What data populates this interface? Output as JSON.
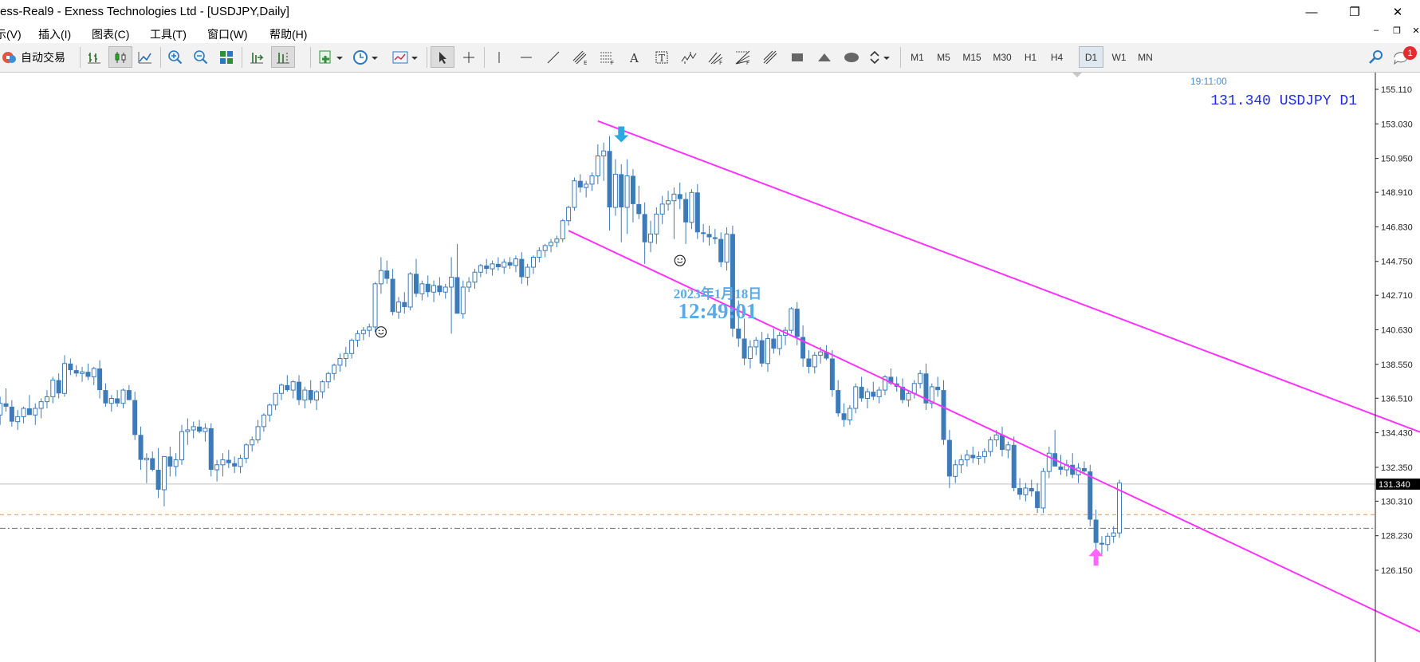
{
  "window": {
    "title": "ess-Real9 - Exness Technologies Ltd - [USDJPY,Daily]",
    "minimize_glyph": "—",
    "restore_glyph": "❐",
    "close_glyph": "✕"
  },
  "menu": {
    "items": [
      "示(V)",
      "插入(I)",
      "图表(C)",
      "工具(T)",
      "窗口(W)",
      "帮助(H)"
    ],
    "mdi_minimize": "–",
    "mdi_restore": "❐",
    "mdi_close": "✕"
  },
  "toolbar": {
    "auto_trade_label": "自动交易",
    "timeframes": [
      "M1",
      "M5",
      "M15",
      "M30",
      "H1",
      "H4",
      "D1",
      "W1",
      "MN"
    ],
    "active_timeframe": "D1",
    "notification_count": "1"
  },
  "chart_data": {
    "type": "candlestick",
    "symbol": "USDJPY",
    "timeframe": "D1",
    "server_time": "19:11:00",
    "price_label": "131.340 USDJPY D1",
    "current_price": 131.34,
    "current_price_tag": "131.340",
    "watermark_date": "2023年1月18日",
    "watermark_time": "12:49:01",
    "ylim": [
      125.4,
      156.5
    ],
    "y_ticks": [
      "155.110",
      "153.030",
      "150.950",
      "148.910",
      "146.830",
      "144.750",
      "142.710",
      "140.630",
      "138.550",
      "136.510",
      "134.430",
      "132.350",
      "130.310",
      "128.230",
      "126.150"
    ],
    "horizontal_lines": [
      {
        "price": 131.34,
        "style": "solid",
        "color": "#c0c0c0"
      },
      {
        "price": 129.5,
        "style": "dashed",
        "color": "#e8914a"
      },
      {
        "price": 128.68,
        "style": "dashdot",
        "color": "#707070"
      }
    ],
    "channel": {
      "color": "#ff33ff",
      "upper": [
        [
          0,
          153.2
        ],
        [
          185,
          129.0
        ]
      ],
      "lower": [
        [
          0,
          146.6
        ],
        [
          185,
          122.0
        ]
      ],
      "start_index": 0
    },
    "markers": [
      {
        "type": "down-arrow",
        "index": 4,
        "price": 152.3,
        "color": "#2aa8e0"
      },
      {
        "type": "up-arrow",
        "index": 82,
        "price": 127.0,
        "color": "#ff66ff"
      },
      {
        "type": "smiley",
        "index": -33,
        "price": 140.5
      },
      {
        "type": "smiley",
        "index": 10,
        "price": 144.8
      }
    ],
    "candles": [
      [
        136.2,
        136.8,
        135.0,
        135.5
      ],
      [
        135.5,
        136.6,
        134.9,
        136.2
      ],
      [
        136.2,
        137.1,
        135.7,
        136.0
      ],
      [
        136.0,
        136.4,
        134.8,
        135.1
      ],
      [
        135.1,
        135.8,
        134.6,
        135.4
      ],
      [
        135.4,
        136.0,
        135.0,
        135.9
      ],
      [
        135.9,
        136.7,
        135.5,
        135.5
      ],
      [
        135.5,
        136.2,
        134.9,
        135.9
      ],
      [
        135.9,
        136.5,
        135.3,
        136.3
      ],
      [
        136.3,
        137.0,
        135.9,
        136.6
      ],
      [
        136.6,
        137.8,
        136.2,
        137.6
      ],
      [
        137.6,
        138.0,
        136.5,
        136.8
      ],
      [
        136.8,
        139.1,
        136.6,
        138.6
      ],
      [
        138.6,
        138.9,
        137.9,
        138.2
      ],
      [
        138.2,
        138.5,
        137.8,
        138.0
      ],
      [
        138.0,
        138.4,
        137.5,
        138.1
      ],
      [
        138.1,
        138.6,
        137.6,
        137.8
      ],
      [
        137.8,
        138.4,
        137.3,
        138.3
      ],
      [
        138.3,
        138.8,
        136.5,
        137.0
      ],
      [
        137.0,
        137.4,
        136.0,
        136.2
      ],
      [
        136.2,
        136.7,
        135.7,
        136.5
      ],
      [
        136.5,
        137.0,
        136.0,
        136.2
      ],
      [
        136.2,
        137.1,
        135.9,
        137.0
      ],
      [
        137.0,
        137.3,
        136.4,
        136.4
      ],
      [
        136.4,
        136.9,
        134.0,
        134.3
      ],
      [
        134.3,
        134.8,
        132.2,
        132.8
      ],
      [
        132.8,
        133.2,
        131.4,
        132.9
      ],
      [
        132.9,
        133.3,
        132.1,
        132.2
      ],
      [
        132.2,
        133.5,
        130.5,
        131.0
      ],
      [
        131.0,
        133.0,
        130.0,
        133.0
      ],
      [
        133.0,
        133.6,
        131.8,
        132.4
      ],
      [
        132.4,
        133.2,
        131.8,
        132.8
      ],
      [
        132.8,
        134.9,
        132.5,
        134.5
      ],
      [
        134.5,
        135.3,
        133.7,
        134.6
      ],
      [
        134.6,
        135.1,
        134.1,
        134.8
      ],
      [
        134.8,
        135.2,
        134.4,
        134.5
      ],
      [
        134.5,
        135.0,
        133.9,
        134.7
      ],
      [
        134.7,
        135.0,
        131.8,
        132.2
      ],
      [
        132.2,
        132.8,
        131.5,
        132.5
      ],
      [
        132.5,
        133.2,
        131.8,
        132.8
      ],
      [
        132.8,
        133.4,
        132.3,
        132.6
      ],
      [
        132.6,
        133.0,
        132.0,
        132.4
      ],
      [
        132.4,
        133.1,
        132.0,
        132.9
      ],
      [
        132.9,
        133.8,
        132.6,
        133.7
      ],
      [
        133.7,
        134.2,
        133.3,
        134.0
      ],
      [
        134.0,
        135.2,
        133.8,
        134.8
      ],
      [
        134.8,
        135.6,
        134.5,
        135.5
      ],
      [
        135.5,
        136.2,
        135.1,
        136.1
      ],
      [
        136.1,
        136.8,
        135.8,
        136.8
      ],
      [
        136.8,
        137.4,
        136.4,
        137.3
      ],
      [
        137.3,
        137.9,
        136.9,
        137.0
      ],
      [
        137.0,
        137.6,
        136.5,
        137.5
      ],
      [
        137.5,
        137.9,
        136.1,
        136.4
      ],
      [
        136.4,
        137.2,
        135.9,
        137.0
      ],
      [
        137.0,
        137.6,
        136.2,
        136.4
      ],
      [
        136.4,
        137.0,
        135.8,
        136.9
      ],
      [
        136.9,
        137.6,
        136.5,
        137.5
      ],
      [
        137.5,
        138.1,
        137.1,
        138.0
      ],
      [
        138.0,
        138.6,
        137.6,
        138.5
      ],
      [
        138.5,
        139.2,
        138.1,
        138.9
      ],
      [
        138.9,
        139.6,
        138.4,
        139.2
      ],
      [
        139.2,
        140.1,
        138.9,
        140.0
      ],
      [
        140.0,
        140.6,
        139.6,
        140.4
      ],
      [
        140.4,
        140.8,
        140.0,
        140.6
      ],
      [
        140.6,
        141.0,
        140.2,
        140.8
      ],
      [
        140.8,
        143.5,
        140.5,
        143.4
      ],
      [
        143.4,
        145.0,
        142.8,
        144.2
      ],
      [
        144.2,
        144.8,
        143.4,
        143.7
      ],
      [
        143.7,
        144.3,
        141.5,
        141.7
      ],
      [
        141.7,
        142.6,
        141.3,
        142.3
      ],
      [
        142.3,
        142.9,
        141.6,
        142.0
      ],
      [
        142.0,
        144.1,
        141.8,
        144.0
      ],
      [
        144.0,
        144.9,
        142.6,
        142.8
      ],
      [
        142.8,
        143.6,
        142.4,
        143.4
      ],
      [
        143.4,
        143.9,
        142.6,
        142.9
      ],
      [
        142.9,
        143.6,
        142.3,
        143.3
      ],
      [
        143.3,
        143.8,
        142.7,
        142.9
      ],
      [
        142.9,
        143.4,
        142.5,
        143.2
      ],
      [
        143.2,
        145.0,
        140.4,
        143.8
      ],
      [
        143.8,
        145.8,
        142.0,
        141.6
      ],
      [
        141.6,
        143.6,
        141.3,
        143.2
      ],
      [
        143.2,
        143.8,
        142.9,
        143.5
      ],
      [
        143.5,
        144.3,
        143.1,
        144.1
      ],
      [
        144.1,
        144.6,
        143.8,
        144.5
      ],
      [
        144.5,
        144.9,
        144.0,
        144.3
      ],
      [
        144.3,
        144.8,
        143.9,
        144.6
      ],
      [
        144.6,
        145.0,
        144.2,
        144.4
      ],
      [
        144.4,
        144.9,
        144.0,
        144.7
      ],
      [
        144.7,
        145.0,
        144.3,
        144.5
      ],
      [
        144.5,
        145.1,
        144.1,
        144.9
      ],
      [
        144.9,
        145.3,
        143.4,
        143.8
      ],
      [
        143.8,
        144.6,
        143.3,
        144.4
      ],
      [
        144.4,
        145.1,
        144.0,
        145.0
      ],
      [
        145.0,
        145.6,
        144.7,
        145.4
      ],
      [
        145.4,
        145.8,
        145.0,
        145.7
      ],
      [
        145.7,
        146.1,
        145.3,
        145.9
      ],
      [
        145.9,
        146.3,
        145.6,
        146.1
      ],
      [
        146.1,
        147.3,
        145.9,
        147.2
      ],
      [
        147.2,
        148.1,
        146.9,
        148.0
      ],
      [
        148.0,
        149.8,
        147.8,
        149.6
      ],
      [
        149.6,
        150.0,
        148.9,
        149.2
      ],
      [
        149.2,
        149.6,
        148.6,
        149.4
      ],
      [
        149.4,
        150.1,
        149.0,
        149.9
      ],
      [
        149.9,
        151.8,
        149.4,
        151.1
      ],
      [
        151.1,
        151.9,
        149.6,
        151.4
      ],
      [
        151.4,
        152.3,
        146.6,
        148.0
      ],
      [
        148.0,
        150.9,
        147.5,
        150.0
      ],
      [
        150.0,
        150.6,
        145.9,
        148.0
      ],
      [
        148.0,
        150.9,
        146.4,
        149.9
      ],
      [
        149.9,
        150.3,
        147.1,
        148.2
      ],
      [
        148.2,
        149.3,
        147.3,
        147.6
      ],
      [
        147.6,
        148.3,
        144.6,
        145.9
      ],
      [
        145.9,
        147.2,
        145.3,
        146.4
      ],
      [
        146.4,
        148.0,
        145.8,
        147.6
      ],
      [
        147.6,
        148.7,
        147.0,
        148.2
      ],
      [
        148.2,
        149.0,
        147.8,
        148.4
      ],
      [
        148.4,
        149.2,
        146.1,
        148.8
      ],
      [
        148.8,
        149.5,
        147.9,
        148.5
      ],
      [
        148.5,
        148.9,
        145.8,
        147.1
      ],
      [
        147.1,
        149.1,
        146.7,
        148.9
      ],
      [
        148.9,
        149.4,
        146.1,
        146.5
      ],
      [
        146.5,
        147.0,
        145.9,
        146.4
      ],
      [
        146.4,
        146.9,
        145.7,
        146.2
      ],
      [
        146.2,
        146.7,
        145.8,
        146.1
      ],
      [
        146.1,
        146.5,
        144.4,
        144.7
      ],
      [
        144.7,
        146.8,
        144.2,
        146.4
      ],
      [
        146.4,
        146.9,
        140.2,
        140.7
      ],
      [
        140.7,
        142.4,
        139.6,
        140.1
      ],
      [
        140.1,
        141.3,
        138.5,
        138.9
      ],
      [
        138.9,
        140.0,
        138.3,
        139.6
      ],
      [
        139.6,
        140.2,
        139.1,
        140.0
      ],
      [
        140.0,
        140.5,
        138.4,
        138.6
      ],
      [
        138.6,
        140.4,
        138.1,
        140.1
      ],
      [
        140.1,
        140.7,
        139.2,
        139.5
      ],
      [
        139.5,
        140.5,
        139.1,
        140.3
      ],
      [
        140.3,
        140.8,
        139.7,
        140.6
      ],
      [
        140.6,
        142.0,
        140.4,
        141.9
      ],
      [
        141.9,
        142.3,
        139.7,
        140.2
      ],
      [
        140.2,
        140.9,
        138.4,
        138.9
      ],
      [
        138.9,
        139.4,
        138.0,
        138.4
      ],
      [
        138.4,
        139.3,
        138.0,
        139.1
      ],
      [
        139.1,
        139.6,
        138.6,
        139.3
      ],
      [
        139.3,
        139.7,
        138.8,
        138.9
      ],
      [
        138.9,
        139.4,
        136.6,
        137.0
      ],
      [
        137.0,
        137.6,
        135.4,
        135.6
      ],
      [
        135.6,
        136.2,
        134.8,
        135.2
      ],
      [
        135.2,
        136.1,
        134.9,
        135.9
      ],
      [
        135.9,
        137.4,
        135.6,
        137.2
      ],
      [
        137.2,
        137.8,
        136.3,
        136.5
      ],
      [
        136.5,
        137.1,
        135.9,
        136.9
      ],
      [
        136.9,
        137.5,
        136.4,
        136.6
      ],
      [
        136.6,
        137.2,
        136.2,
        137.0
      ],
      [
        137.0,
        137.9,
        136.7,
        137.8
      ],
      [
        137.8,
        138.3,
        137.3,
        137.4
      ],
      [
        137.4,
        137.8,
        136.9,
        137.2
      ],
      [
        137.2,
        137.7,
        136.2,
        136.4
      ],
      [
        136.4,
        137.0,
        136.0,
        136.8
      ],
      [
        136.8,
        137.6,
        136.5,
        137.4
      ],
      [
        137.4,
        138.2,
        137.1,
        138.0
      ],
      [
        138.0,
        138.6,
        135.8,
        136.2
      ],
      [
        136.2,
        137.4,
        135.9,
        137.2
      ],
      [
        137.2,
        137.8,
        136.6,
        137.0
      ],
      [
        137.0,
        137.6,
        133.7,
        134.0
      ],
      [
        134.0,
        134.6,
        131.1,
        131.8
      ],
      [
        131.8,
        132.8,
        131.4,
        132.5
      ],
      [
        132.5,
        133.1,
        132.0,
        132.8
      ],
      [
        132.8,
        133.4,
        132.4,
        133.1
      ],
      [
        133.1,
        133.6,
        132.6,
        132.9
      ],
      [
        132.9,
        133.3,
        132.5,
        133.0
      ],
      [
        133.0,
        133.5,
        132.6,
        133.3
      ],
      [
        133.3,
        134.2,
        133.0,
        134.0
      ],
      [
        134.0,
        134.6,
        133.6,
        134.3
      ],
      [
        134.3,
        134.8,
        133.0,
        133.4
      ],
      [
        133.4,
        133.9,
        132.9,
        133.7
      ],
      [
        133.7,
        134.2,
        130.9,
        131.1
      ],
      [
        131.1,
        131.7,
        130.4,
        130.7
      ],
      [
        130.7,
        131.4,
        130.3,
        131.1
      ],
      [
        131.1,
        131.6,
        130.6,
        130.9
      ],
      [
        130.9,
        131.4,
        129.6,
        129.9
      ],
      [
        129.9,
        132.3,
        129.6,
        132.1
      ],
      [
        132.1,
        133.6,
        131.7,
        133.2
      ],
      [
        133.2,
        134.6,
        132.8,
        132.4
      ],
      [
        132.4,
        133.1,
        131.9,
        132.2
      ],
      [
        132.2,
        132.8,
        131.8,
        132.5
      ],
      [
        132.5,
        133.2,
        131.7,
        131.9
      ],
      [
        131.9,
        132.6,
        131.4,
        132.3
      ],
      [
        132.3,
        132.7,
        131.9,
        132.1
      ],
      [
        132.1,
        132.5,
        128.8,
        129.2
      ],
      [
        129.2,
        129.8,
        127.2,
        127.8
      ],
      [
        127.8,
        128.2,
        127.1,
        127.7
      ],
      [
        127.7,
        128.4,
        127.3,
        128.2
      ],
      [
        128.2,
        128.8,
        127.8,
        128.4
      ],
      [
        128.4,
        131.6,
        128.1,
        131.4
      ]
    ]
  }
}
